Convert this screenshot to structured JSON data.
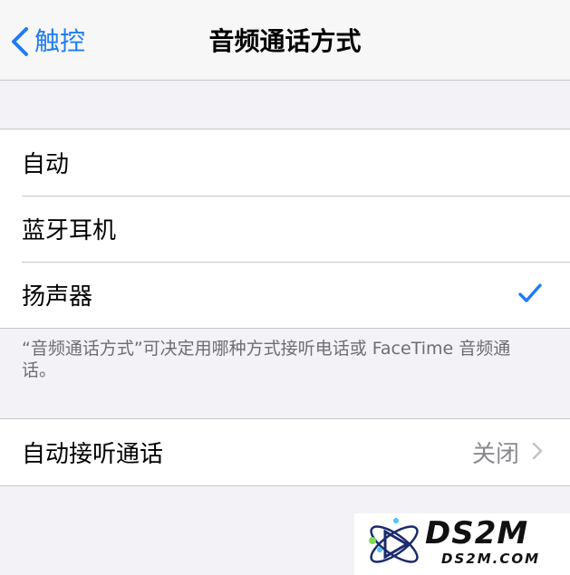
{
  "nav": {
    "back_label": "触控",
    "title": "音频通话方式"
  },
  "routing": {
    "items": [
      {
        "label": "自动",
        "checked": false
      },
      {
        "label": "蓝牙耳机",
        "checked": false
      },
      {
        "label": "扬声器",
        "checked": true
      }
    ],
    "footer": "“音频通话方式”可决定用哪种方式接听电话或 FaceTime 音频通话。"
  },
  "auto_answer": {
    "label": "自动接听通话",
    "value": "关闭"
  },
  "watermark": {
    "brand": "DS2M",
    "site": "DS2M.COM"
  },
  "colors": {
    "accent": "#1f7cf4",
    "background": "#f2f2f7",
    "secondary_text": "#8a8a8e"
  },
  "icons": {
    "back": "chevron-left-icon",
    "check": "checkmark-icon",
    "disclosure": "chevron-right-icon"
  }
}
